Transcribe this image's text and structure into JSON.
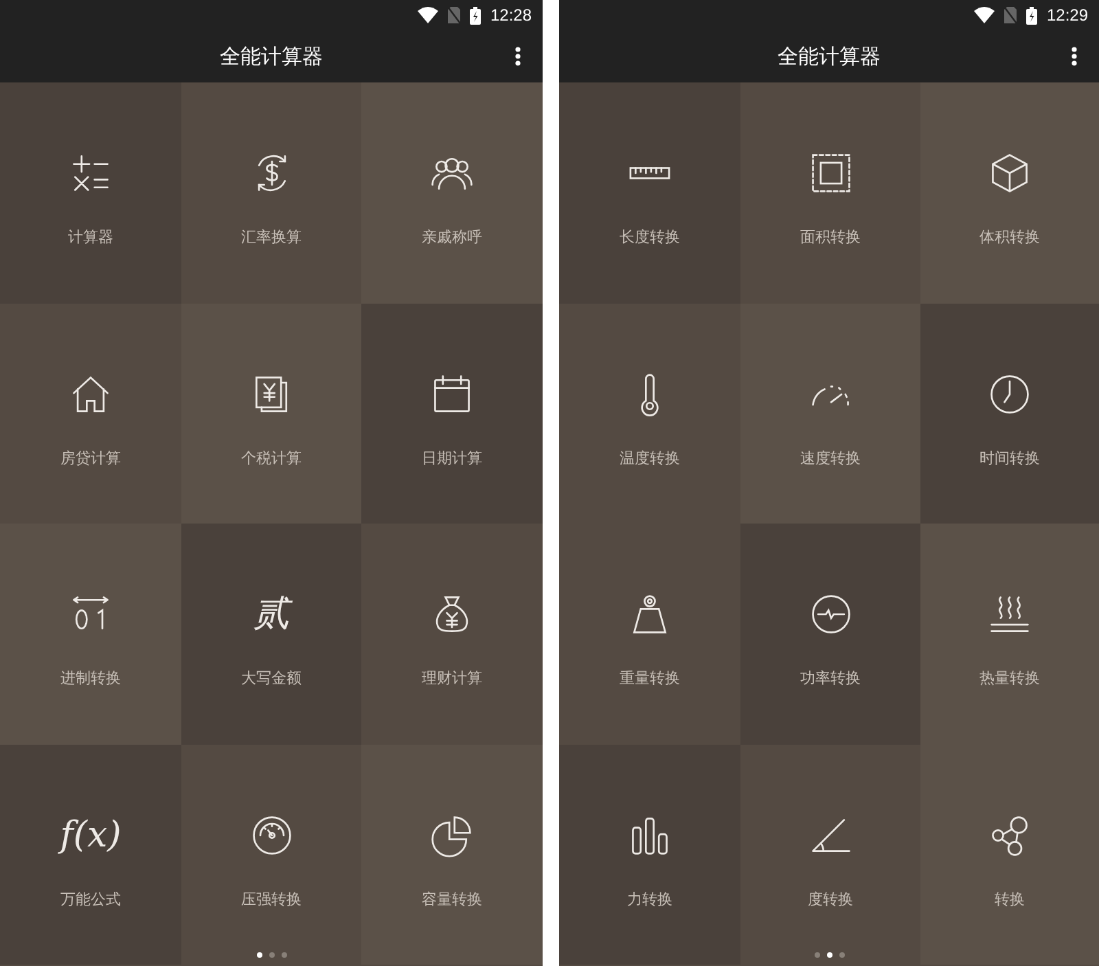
{
  "screens": [
    {
      "status_bar": {
        "time": "12:28"
      },
      "app_bar": {
        "title": "全能计算器"
      },
      "tiles": [
        {
          "label": "计算器",
          "color": "#4a413b"
        },
        {
          "label": "汇率换算",
          "color": "#544a42"
        },
        {
          "label": "亲戚称呼",
          "color": "#5b5148"
        },
        {
          "label": "房贷计算",
          "color": "#544a42"
        },
        {
          "label": "个税计算",
          "color": "#5b5148"
        },
        {
          "label": "日期计算",
          "color": "#4a413b"
        },
        {
          "label": "进制转换",
          "color": "#5b5148"
        },
        {
          "label": "大写金额",
          "color": "#4a413b",
          "glyph": "贰"
        },
        {
          "label": "理财计算",
          "color": "#544a42"
        },
        {
          "label": "万能公式",
          "color": "#4a413b",
          "glyph": "f(x)"
        },
        {
          "label": "压强转换",
          "color": "#544a42"
        },
        {
          "label": "容量转换",
          "color": "#5b5148"
        }
      ],
      "pager": [
        {
          "selected": true
        },
        {
          "selected": false
        },
        {
          "selected": false
        }
      ]
    },
    {
      "status_bar": {
        "time": "12:29"
      },
      "app_bar": {
        "title": "全能计算器"
      },
      "tiles": [
        {
          "label": "长度转换",
          "color": "#4a413b"
        },
        {
          "label": "面积转换",
          "color": "#544a42"
        },
        {
          "label": "体积转换",
          "color": "#5b5148"
        },
        {
          "label": "温度转换",
          "color": "#544a42"
        },
        {
          "label": "速度转换",
          "color": "#5b5148"
        },
        {
          "label": "时间转换",
          "color": "#4a413b"
        },
        {
          "label": "重量转换",
          "color": "#544a42"
        },
        {
          "label": "功率转换",
          "color": "#4a413b"
        },
        {
          "label": "热量转换",
          "color": "#5b5148"
        },
        {
          "label": "力转换",
          "color": "#4a413b"
        },
        {
          "label": "度转换",
          "color": "#544a42"
        },
        {
          "label": "转换",
          "color": "#5b5148"
        }
      ],
      "pager": [
        {
          "selected": false
        },
        {
          "selected": true
        },
        {
          "selected": false
        }
      ]
    }
  ]
}
